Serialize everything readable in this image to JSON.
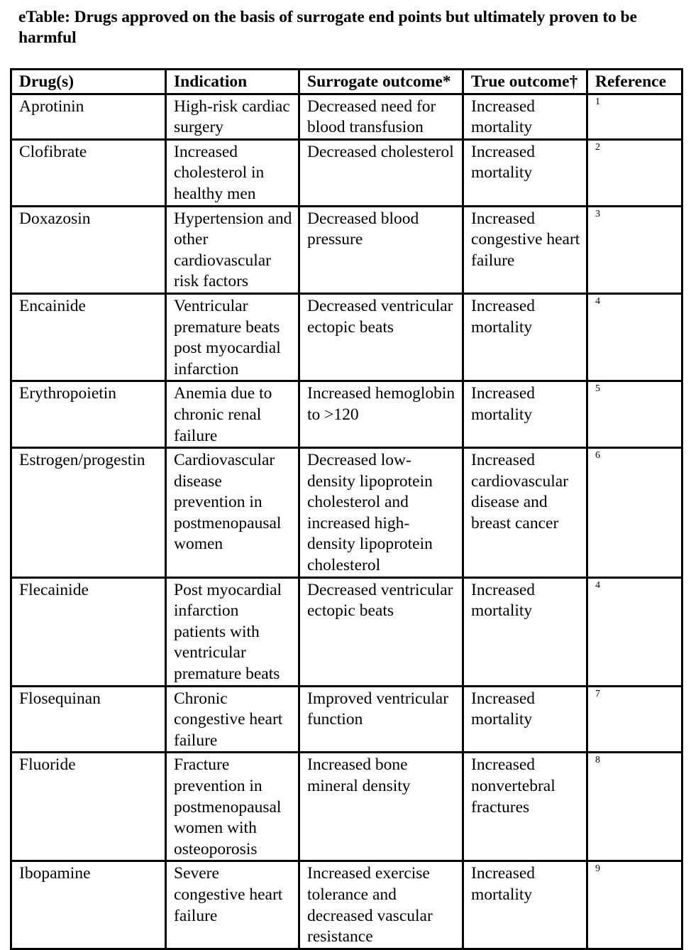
{
  "title": "eTable: Drugs approved on the basis of surrogate end points but ultimately proven to be harmful",
  "table": {
    "headers": [
      "Drug(s)",
      "Indication",
      "Surrogate outcome*",
      "True outcome†",
      "Reference"
    ],
    "rows": [
      {
        "drug": "Aprotinin",
        "indication": "High-risk cardiac surgery",
        "surrogate": "Decreased need for blood transfusion",
        "true_outcome": "Increased mortality",
        "reference": "1"
      },
      {
        "drug": "Clofibrate",
        "indication": "Increased cholesterol in healthy men",
        "surrogate": "Decreased cholesterol",
        "true_outcome": "Increased mortality",
        "reference": "2"
      },
      {
        "drug": "Doxazosin",
        "indication": "Hypertension and other cardiovascular risk factors",
        "surrogate": "Decreased blood pressure",
        "true_outcome": "Increased congestive heart failure",
        "reference": "3"
      },
      {
        "drug": "Encainide",
        "indication": "Ventricular premature beats post myocardial infarction",
        "surrogate": "Decreased ventricular ectopic beats",
        "true_outcome": "Increased mortality",
        "reference": "4"
      },
      {
        "drug": "Erythropoietin",
        "indication": "Anemia due to chronic renal failure",
        "surrogate": "Increased hemoglobin to >120",
        "true_outcome": "Increased mortality",
        "reference": "5"
      },
      {
        "drug": "Estrogen/progestin",
        "indication": "Cardiovascular disease prevention in postmenopausal women",
        "surrogate": "Decreased low-density lipoprotein cholesterol and increased high-density lipoprotein cholesterol",
        "true_outcome": "Increased cardiovascular disease and breast cancer",
        "reference": "6"
      },
      {
        "drug": "Flecainide",
        "indication": "Post myocardial infarction patients with ventricular premature beats",
        "surrogate": "Decreased ventricular ectopic beats",
        "true_outcome": "Increased mortality",
        "reference": "4"
      },
      {
        "drug": "Flosequinan",
        "indication": "Chronic congestive heart failure",
        "surrogate": "Improved ventricular function",
        "true_outcome": "Increased mortality",
        "reference": "7"
      },
      {
        "drug": "Fluoride",
        "indication": "Fracture prevention in postmenopausal women with osteoporosis",
        "surrogate": "Increased bone mineral density",
        "true_outcome": "Increased nonvertebral fractures",
        "reference": "8"
      },
      {
        "drug": "Ibopamine",
        "indication": "Severe congestive heart failure",
        "surrogate": "Increased exercise tolerance and decreased vascular resistance",
        "true_outcome": "Increased mortality",
        "reference": "9"
      }
    ]
  }
}
